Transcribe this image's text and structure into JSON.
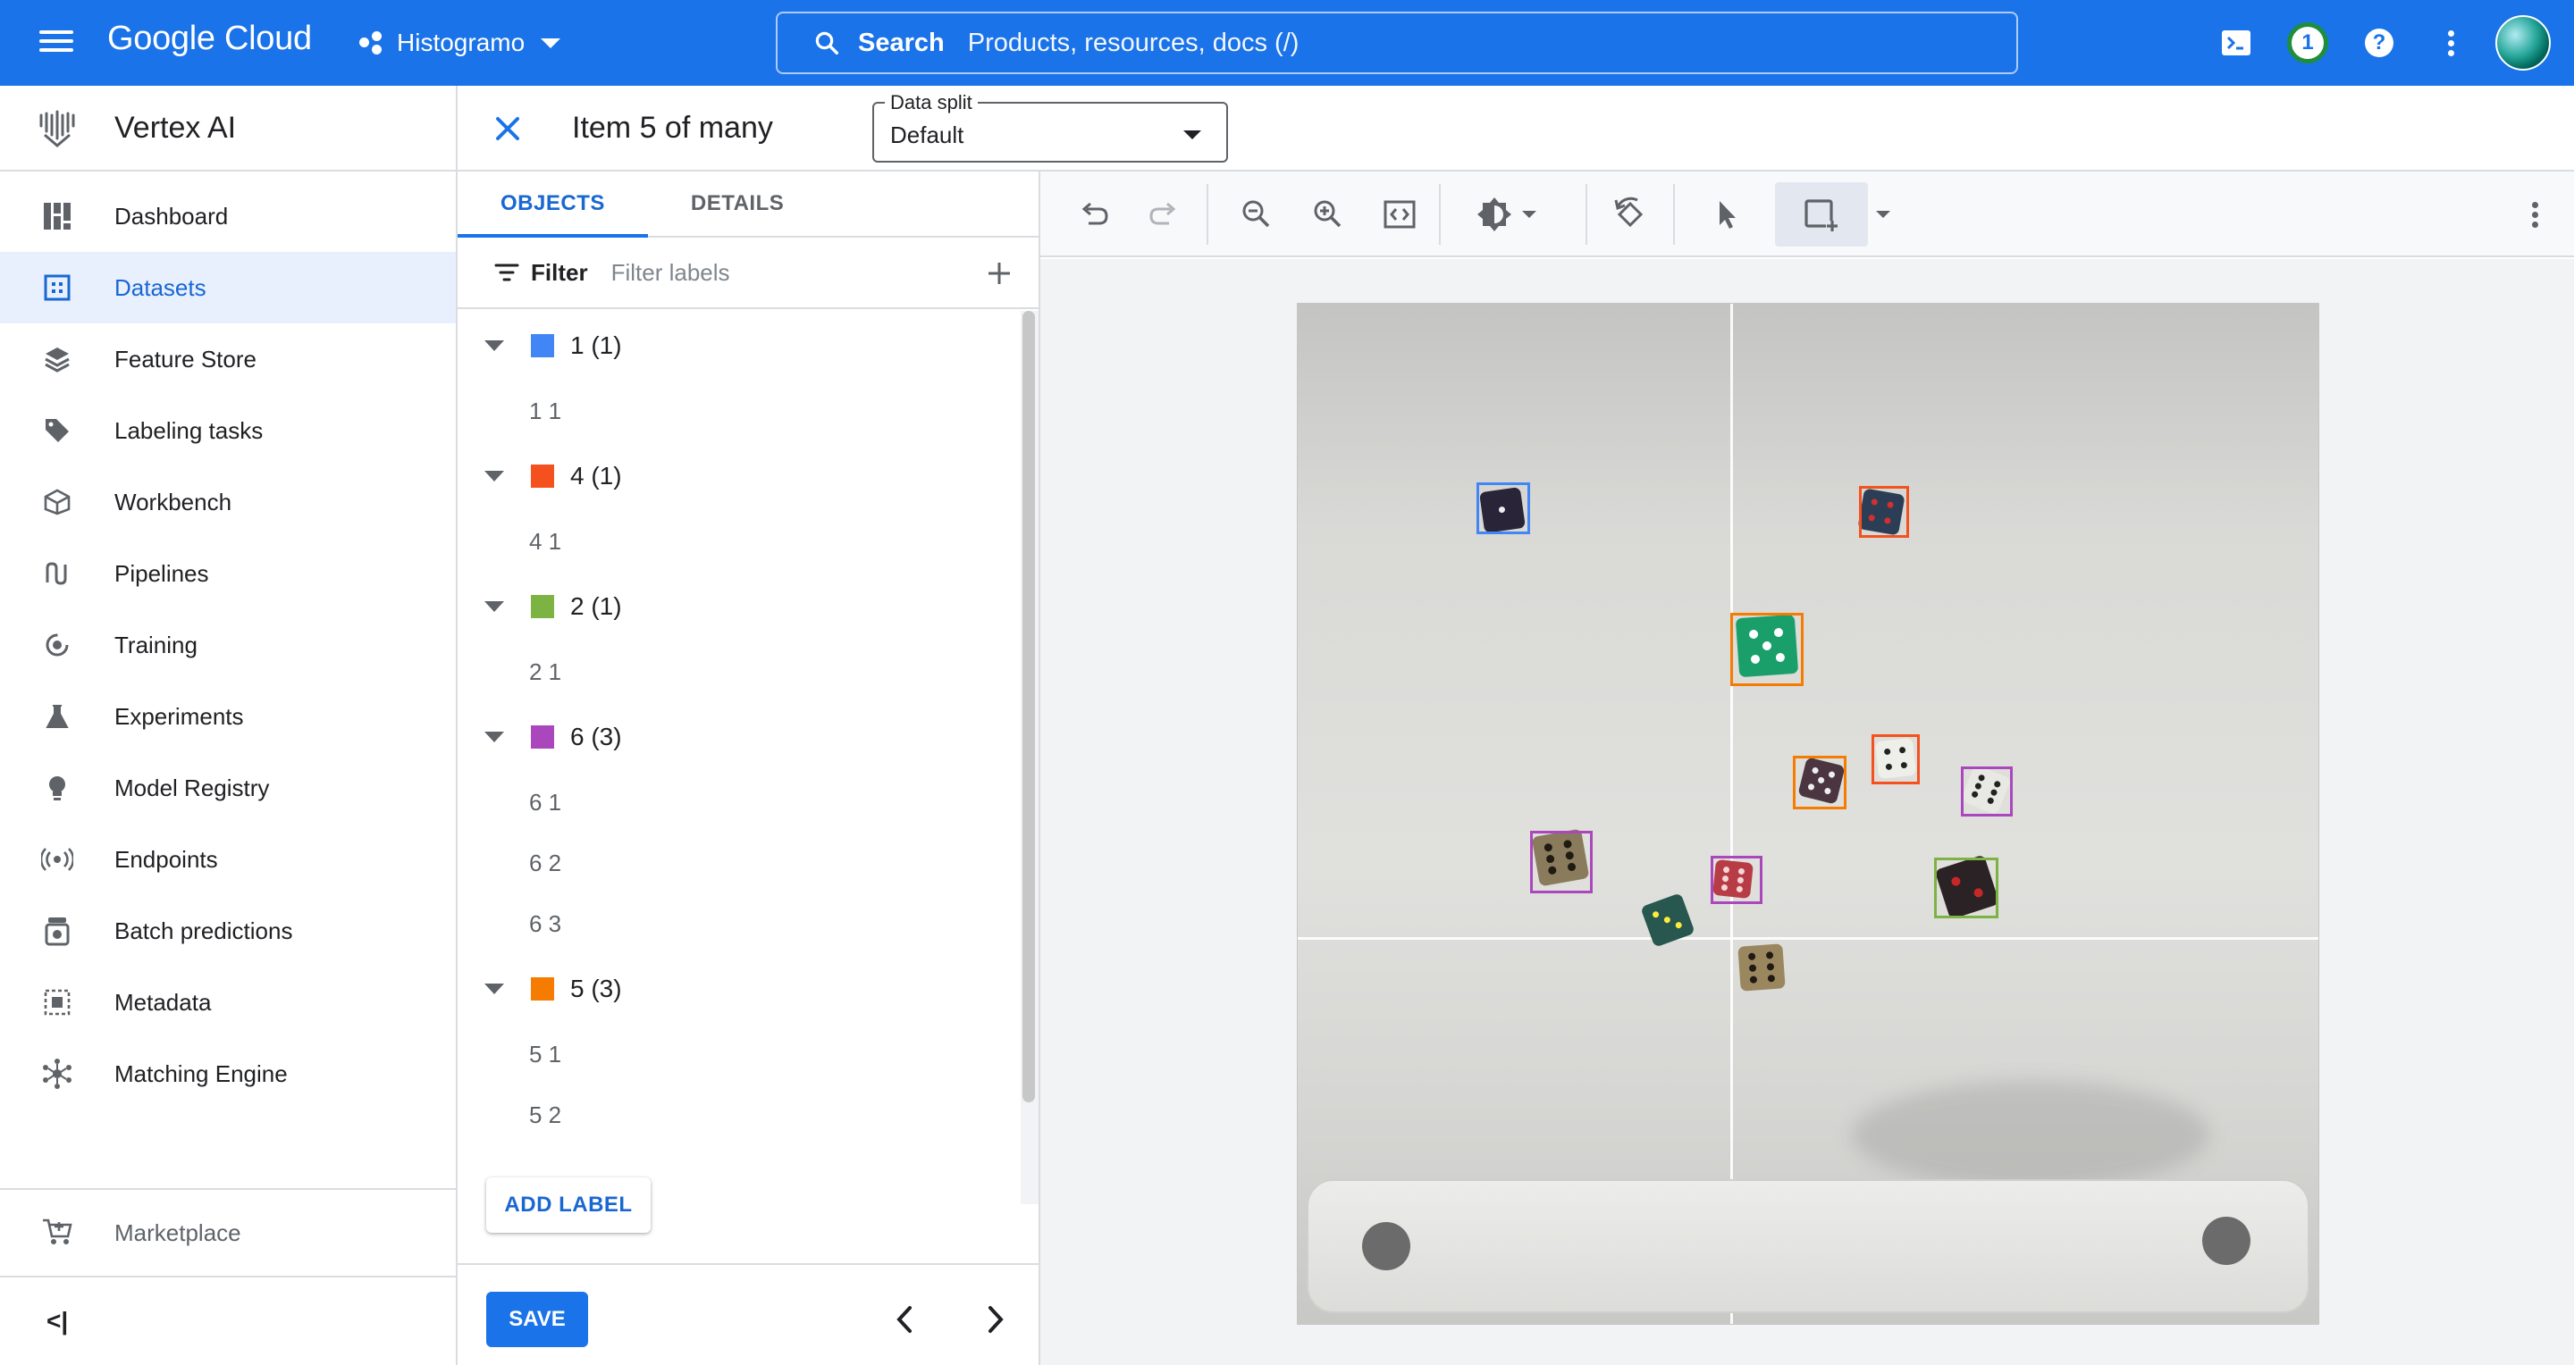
{
  "topbar": {
    "logo_text": "Google Cloud",
    "project_name": "Histogramo",
    "search_label": "Search",
    "search_placeholder": "Products, resources, docs (/)",
    "notification_count": "1",
    "help_label": "?"
  },
  "sidenav": {
    "product_title": "Vertex AI",
    "items": [
      {
        "label": "Dashboard",
        "icon": "dashboard-icon"
      },
      {
        "label": "Datasets",
        "icon": "datasets-icon",
        "active": true
      },
      {
        "label": "Feature Store",
        "icon": "feature-store-icon"
      },
      {
        "label": "Labeling tasks",
        "icon": "tag-icon"
      },
      {
        "label": "Workbench",
        "icon": "workbench-icon"
      },
      {
        "label": "Pipelines",
        "icon": "pipelines-icon"
      },
      {
        "label": "Training",
        "icon": "training-icon"
      },
      {
        "label": "Experiments",
        "icon": "flask-icon"
      },
      {
        "label": "Model Registry",
        "icon": "lightbulb-icon"
      },
      {
        "label": "Endpoints",
        "icon": "endpoints-icon"
      },
      {
        "label": "Batch predictions",
        "icon": "batch-icon"
      },
      {
        "label": "Metadata",
        "icon": "metadata-icon"
      },
      {
        "label": "Matching Engine",
        "icon": "matching-engine-icon"
      }
    ],
    "marketplace_label": "Marketplace",
    "collapse_label": "<|"
  },
  "header": {
    "item_title": "Item 5 of many",
    "data_split_legend": "Data split",
    "data_split_value": "Default"
  },
  "panel": {
    "tabs": [
      "OBJECTS",
      "DETAILS"
    ],
    "filter_label": "Filter",
    "filter_placeholder": "Filter labels",
    "groups": [
      {
        "name": "1 (1)",
        "color": "#4285f4",
        "instances": [
          "1 1"
        ]
      },
      {
        "name": "4 (1)",
        "color": "#f4511e",
        "instances": [
          "4 1"
        ]
      },
      {
        "name": "2 (1)",
        "color": "#7cb342",
        "instances": [
          "2 1"
        ]
      },
      {
        "name": "6 (3)",
        "color": "#ab47bc",
        "instances": [
          "6 1",
          "6 2",
          "6 3"
        ]
      },
      {
        "name": "5 (3)",
        "color": "#f57c00",
        "instances": [
          "5 1",
          "5 2"
        ]
      }
    ],
    "add_label_button": "ADD LABEL",
    "save_button": "SAVE"
  },
  "colors": {
    "brand_blue": "#1a73e8",
    "active_nav_bg": "#e8f0fe",
    "label_1": "#4285f4",
    "label_4": "#f4511e",
    "label_2": "#7cb342",
    "label_6": "#ab47bc",
    "label_5": "#f57c00"
  }
}
